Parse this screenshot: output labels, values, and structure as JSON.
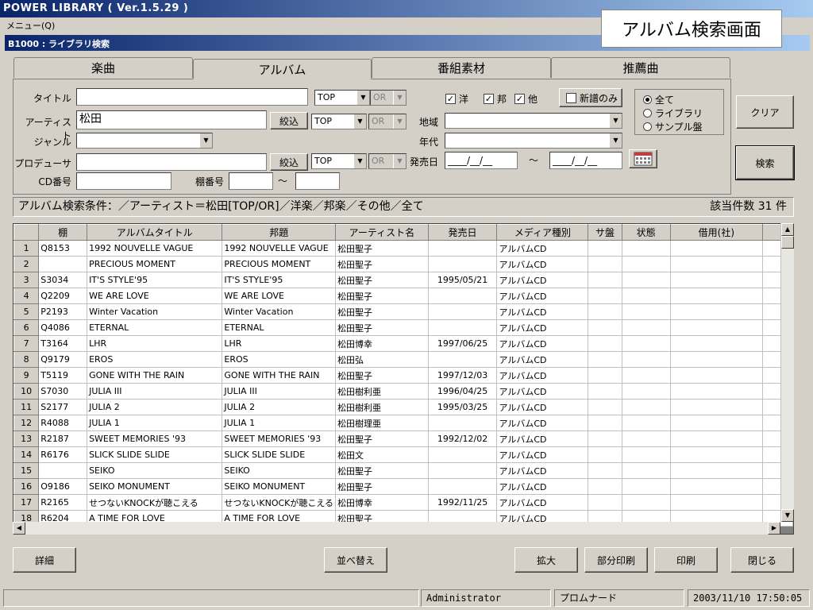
{
  "window": {
    "title": "POWER LIBRARY ( Ver.1.5.29 )",
    "menu": "メニュー(Q)"
  },
  "overlay_label": "アルバム検索画面",
  "form": {
    "title": "B1000 : ライブラリ検索",
    "tabs": [
      "楽曲",
      "アルバム",
      "番組素材",
      "推薦曲"
    ],
    "active_tab": "アルバム"
  },
  "search": {
    "title_label": "タイトル",
    "title_value": "",
    "title_match": "TOP",
    "title_logic": "OR",
    "artist_label": "アーティスト",
    "artist_value": "松田",
    "artist_narrow": "絞込",
    "artist_match": "TOP",
    "artist_logic": "OR",
    "genre_label": "ジャンル",
    "producer_label": "プロデューサ",
    "producer_narrow": "絞込",
    "producer_match": "TOP",
    "producer_logic": "OR",
    "cd_label": "CD番号",
    "shelf_label": "棚番号",
    "tilde": "～",
    "checks": [
      {
        "label": "洋",
        "checked": true
      },
      {
        "label": "邦",
        "checked": true
      },
      {
        "label": "他",
        "checked": true
      }
    ],
    "new_only": {
      "label": "新譜のみ",
      "checked": false
    },
    "region_label": "地域",
    "era_label": "年代",
    "release_label": "発売日",
    "date_from": "____/__/__",
    "date_to": "____/__/__",
    "radios": [
      {
        "label": "全て",
        "selected": true
      },
      {
        "label": "ライブラリ",
        "selected": false
      },
      {
        "label": "サンプル盤",
        "selected": false
      }
    ],
    "clear_button": "クリア",
    "search_button": "検索"
  },
  "condition": {
    "text": "アルバム検索条件：／アーティスト＝松田[TOP/OR]／洋楽／邦楽／その他／全て",
    "count": "該当件数 31 件"
  },
  "table": {
    "columns": [
      "棚",
      "アルバムタイトル",
      "邦題",
      "アーティスト名",
      "発売日",
      "メディア種別",
      "サ盤",
      "状態",
      "借用(社)"
    ],
    "rows": [
      [
        "1",
        "Q8153",
        "1992 NOUVELLE VAGUE",
        "1992 NOUVELLE VAGUE",
        "松田聖子",
        "",
        "アルバムCD",
        "",
        "",
        ""
      ],
      [
        "2",
        "",
        "PRECIOUS MOMENT",
        "PRECIOUS MOMENT",
        "松田聖子",
        "",
        "アルバムCD",
        "",
        "",
        ""
      ],
      [
        "3",
        "S3034",
        "IT'S STYLE'95",
        "IT'S STYLE'95",
        "松田聖子",
        "1995/05/21",
        "アルバムCD",
        "",
        "",
        ""
      ],
      [
        "4",
        "Q2209",
        "WE ARE LOVE",
        "WE ARE LOVE",
        "松田聖子",
        "",
        "アルバムCD",
        "",
        "",
        ""
      ],
      [
        "5",
        "P2193",
        "Winter Vacation",
        "Winter Vacation",
        "松田聖子",
        "",
        "アルバムCD",
        "",
        "",
        ""
      ],
      [
        "6",
        "Q4086",
        "ETERNAL",
        "ETERNAL",
        "松田聖子",
        "",
        "アルバムCD",
        "",
        "",
        ""
      ],
      [
        "7",
        "T3164",
        "LHR",
        "LHR",
        "松田博幸",
        "1997/06/25",
        "アルバムCD",
        "",
        "",
        ""
      ],
      [
        "8",
        "Q9179",
        "EROS",
        "EROS",
        "松田弘",
        "",
        "アルバムCD",
        "",
        "",
        ""
      ],
      [
        "9",
        "T5119",
        "GONE WITH THE RAIN",
        "GONE WITH THE RAIN",
        "松田聖子",
        "1997/12/03",
        "アルバムCD",
        "",
        "",
        ""
      ],
      [
        "10",
        "S7030",
        "JULIA III",
        "JULIA III",
        "松田樹利亜",
        "1996/04/25",
        "アルバムCD",
        "",
        "",
        ""
      ],
      [
        "11",
        "S2177",
        "JULIA 2",
        "JULIA 2",
        "松田樹利亜",
        "1995/03/25",
        "アルバムCD",
        "",
        "",
        ""
      ],
      [
        "12",
        "R4088",
        "JULIA 1",
        "JULIA 1",
        "松田樹理亜",
        "",
        "アルバムCD",
        "",
        "",
        ""
      ],
      [
        "13",
        "R2187",
        "SWEET MEMORIES '93",
        "SWEET MEMORIES '93",
        "松田聖子",
        "1992/12/02",
        "アルバムCD",
        "",
        "",
        ""
      ],
      [
        "14",
        "R6176",
        "SLICK SLIDE SLIDE",
        "SLICK SLIDE SLIDE",
        "松田文",
        "",
        "アルバムCD",
        "",
        "",
        ""
      ],
      [
        "15",
        "",
        "SEIKO",
        "SEIKO",
        "松田聖子",
        "",
        "アルバムCD",
        "",
        "",
        ""
      ],
      [
        "16",
        "O9186",
        "SEIKO MONUMENT",
        "SEIKO MONUMENT",
        "松田聖子",
        "",
        "アルバムCD",
        "",
        "",
        ""
      ],
      [
        "17",
        "R2165",
        "せつないKNOCKが聴こえる",
        "せつないKNOCKが聴こえる",
        "松田博幸",
        "1992/11/25",
        "アルバムCD",
        "",
        "",
        ""
      ],
      [
        "18",
        "R6204",
        "A TIME FOR LOVE",
        "A TIME FOR LOVE",
        "松田聖子",
        "",
        "アルバムCD",
        "",
        "",
        ""
      ]
    ]
  },
  "buttons": {
    "detail": "詳細",
    "sort": "並べ替え",
    "zoom": "拡大",
    "partial_print": "部分印刷",
    "print": "印刷",
    "close": "閉じる"
  },
  "status": {
    "user": "Administrator",
    "station": "プロムナード",
    "datetime": "2003/11/10  17:50:05"
  }
}
